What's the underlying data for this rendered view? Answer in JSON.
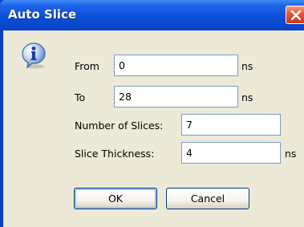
{
  "dialog": {
    "title": "Auto Slice",
    "close_icon": "close-icon",
    "info_icon": "info-icon"
  },
  "fields": {
    "from": {
      "label": "From",
      "value": "0",
      "unit": "ns"
    },
    "to": {
      "label": "To",
      "value": "28",
      "unit": "ns"
    },
    "num_slices": {
      "label": "Number of Slices:",
      "value": "7"
    },
    "thickness": {
      "label": "Slice Thickness:",
      "value": "4",
      "unit": "ns"
    }
  },
  "buttons": {
    "ok": "OK",
    "cancel": "Cancel"
  },
  "colors": {
    "titlebar": "#0a4fd8",
    "client_bg": "#ece9d8",
    "close_button": "#e2573a",
    "field_border": "#7f9db9"
  }
}
